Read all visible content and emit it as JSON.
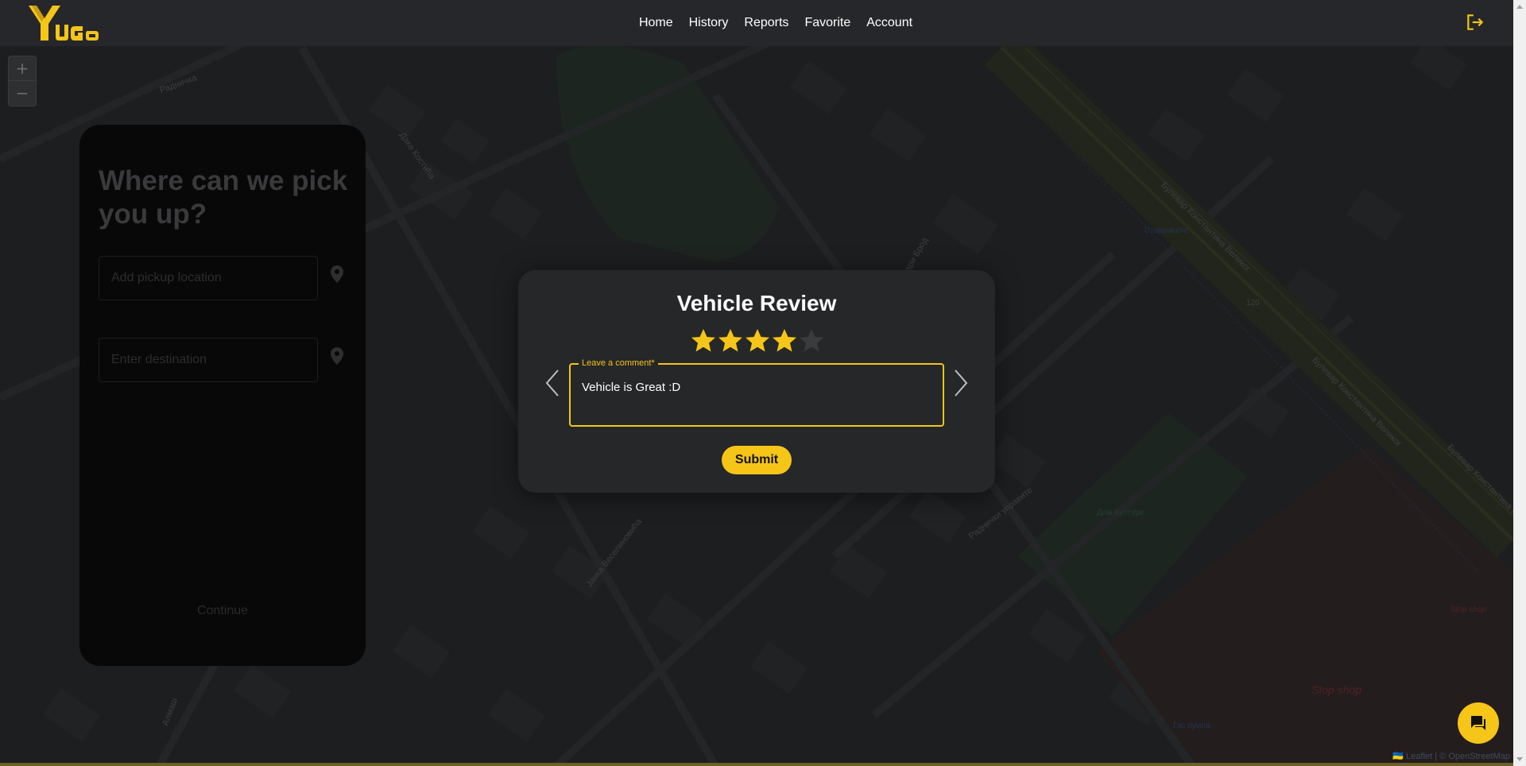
{
  "brand": {
    "logo_text": "YuGo",
    "accent": "#f5c518",
    "background": "#26272a"
  },
  "nav": {
    "links": [
      "Home",
      "History",
      "Reports",
      "Favorite",
      "Account"
    ],
    "logout_icon": "logout-icon"
  },
  "map": {
    "zoom_in": "+",
    "zoom_out": "−",
    "labels": {
      "street1": "Радничка",
      "street2": "Даке Костића",
      "street3": "Булевар Константина Великог",
      "street4": "Булевар Константина Великог",
      "street5": "Булевар Константина Великог",
      "street6": "Раднички управите",
      "street7": "Јанка Веселиновића",
      "street8": "Алмаш",
      "street9": "Стари Брод",
      "park": "Дом Културе",
      "shop": "Stop shop",
      "shop2": "Stop shop",
      "number": "120",
      "bus": "Стајалиште",
      "fuel": "Гас пумпа"
    },
    "attribution": "🇺🇦 Leaflet | © OpenStreetMap"
  },
  "side_panel": {
    "title": "Where can we pick you up?",
    "pickup_placeholder": "Add pickup location",
    "destination_placeholder": "Enter destination",
    "continue_label": "Continue"
  },
  "review_modal": {
    "title": "Vehicle Review",
    "rating": 4,
    "max_rating": 5,
    "comment_label": "Leave a comment*",
    "comment_value": "Vehicle is Great :D",
    "submit_label": "Submit"
  },
  "chat": {
    "icon": "chat-icon"
  }
}
